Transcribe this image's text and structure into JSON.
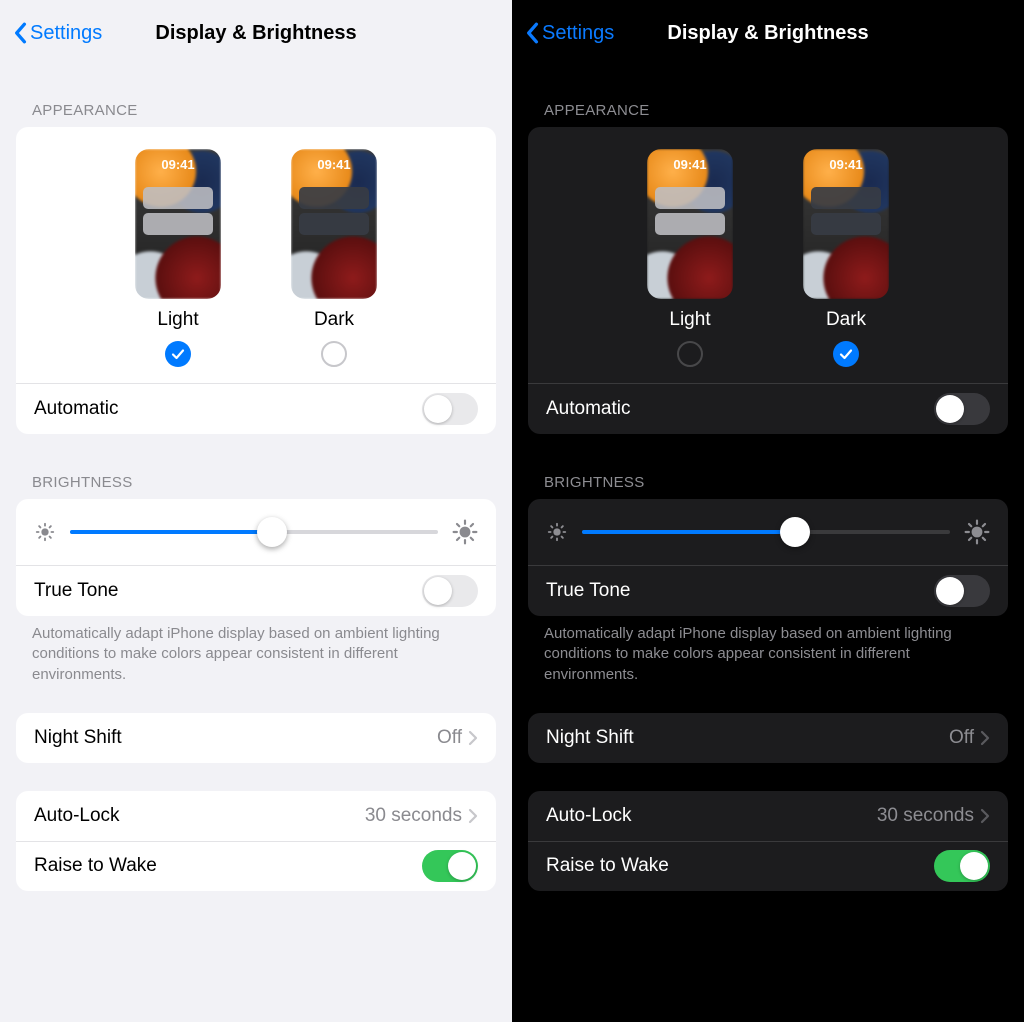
{
  "left": {
    "theme": "light",
    "nav": {
      "back": "Settings",
      "title": "Display & Brightness"
    },
    "appearance": {
      "header": "Appearance",
      "options": [
        {
          "label": "Light",
          "selected": true,
          "time": "09:41"
        },
        {
          "label": "Dark",
          "selected": false,
          "time": "09:41"
        }
      ],
      "automatic": {
        "label": "Automatic",
        "on": false
      }
    },
    "brightness": {
      "header": "Brightness",
      "value_percent": 55,
      "trueTone": {
        "label": "True Tone",
        "on": false
      },
      "note": "Automatically adapt iPhone display based on ambient lighting conditions to make colors appear consistent in different environments."
    },
    "nightShift": {
      "label": "Night Shift",
      "value": "Off"
    },
    "autoLock": {
      "label": "Auto-Lock",
      "value": "30 seconds"
    },
    "raiseToWake": {
      "label": "Raise to Wake",
      "on": true
    }
  },
  "right": {
    "theme": "dark",
    "nav": {
      "back": "Settings",
      "title": "Display & Brightness"
    },
    "appearance": {
      "header": "Appearance",
      "options": [
        {
          "label": "Light",
          "selected": false,
          "time": "09:41"
        },
        {
          "label": "Dark",
          "selected": true,
          "time": "09:41"
        }
      ],
      "automatic": {
        "label": "Automatic",
        "on": false
      }
    },
    "brightness": {
      "header": "Brightness",
      "value_percent": 58,
      "trueTone": {
        "label": "True Tone",
        "on": false
      },
      "note": "Automatically adapt iPhone display based on ambient lighting conditions to make colors appear consistent in different environments."
    },
    "nightShift": {
      "label": "Night Shift",
      "value": "Off"
    },
    "autoLock": {
      "label": "Auto-Lock",
      "value": "30 seconds"
    },
    "raiseToWake": {
      "label": "Raise to Wake",
      "on": true
    }
  },
  "colors": {
    "accent": "#007aff",
    "green": "#34c759"
  }
}
